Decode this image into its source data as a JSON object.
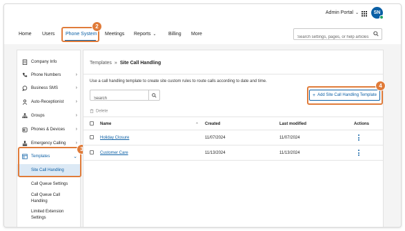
{
  "header": {
    "portal_label": "Admin Portal",
    "avatar_initials": "SN",
    "search_placeholder": "Search settings, pages, or help articles"
  },
  "nav": {
    "items": [
      {
        "label": "Home"
      },
      {
        "label": "Users"
      },
      {
        "label": "Phone System",
        "active": true
      },
      {
        "label": "Meetings"
      },
      {
        "label": "Reports"
      },
      {
        "label": "Billing"
      },
      {
        "label": "More"
      }
    ]
  },
  "sidebar": {
    "items": [
      {
        "label": "Company Info",
        "icon": "building-icon"
      },
      {
        "label": "Phone Numbers",
        "icon": "phone-icon"
      },
      {
        "label": "Business SMS",
        "icon": "chat-icon"
      },
      {
        "label": "Auto-Receptionist",
        "icon": "person-icon"
      },
      {
        "label": "Groups",
        "icon": "groups-icon"
      },
      {
        "label": "Phones & Devices",
        "icon": "desk-phone-icon"
      },
      {
        "label": "Emergency Calling",
        "icon": "emergency-icon"
      },
      {
        "label": "Templates",
        "icon": "template-icon"
      }
    ],
    "sub_items": [
      {
        "label": "Site Call Handling",
        "active": true
      },
      {
        "label": "Call Queue Settings"
      },
      {
        "label": "Call Queue Call Handling"
      },
      {
        "label": "Limited Extension Settings"
      }
    ]
  },
  "main": {
    "breadcrumb_parent": "Templates",
    "breadcrumb_sep": "»",
    "breadcrumb_current": "Site Call Handling",
    "description": "Use a call handling template to create site custom rules to route calls according to date and time.",
    "search_placeholder": "Search",
    "add_button": "Add Site Call Handling Template",
    "delete_label": "Delete",
    "columns": {
      "name": "Name",
      "created": "Created",
      "modified": "Last modified",
      "actions": "Actions"
    },
    "rows": [
      {
        "name": "Holiday Closure",
        "created": "11/07/2024",
        "modified": "11/07/2024"
      },
      {
        "name": "Customer Care",
        "created": "11/13/2024",
        "modified": "11/13/2024"
      }
    ]
  },
  "callouts": [
    "2",
    "3",
    "4"
  ],
  "colors": {
    "accent": "#0b5fa5",
    "callout": "#e07b39",
    "active_bg": "#dce9f5",
    "online": "#1fa463"
  }
}
